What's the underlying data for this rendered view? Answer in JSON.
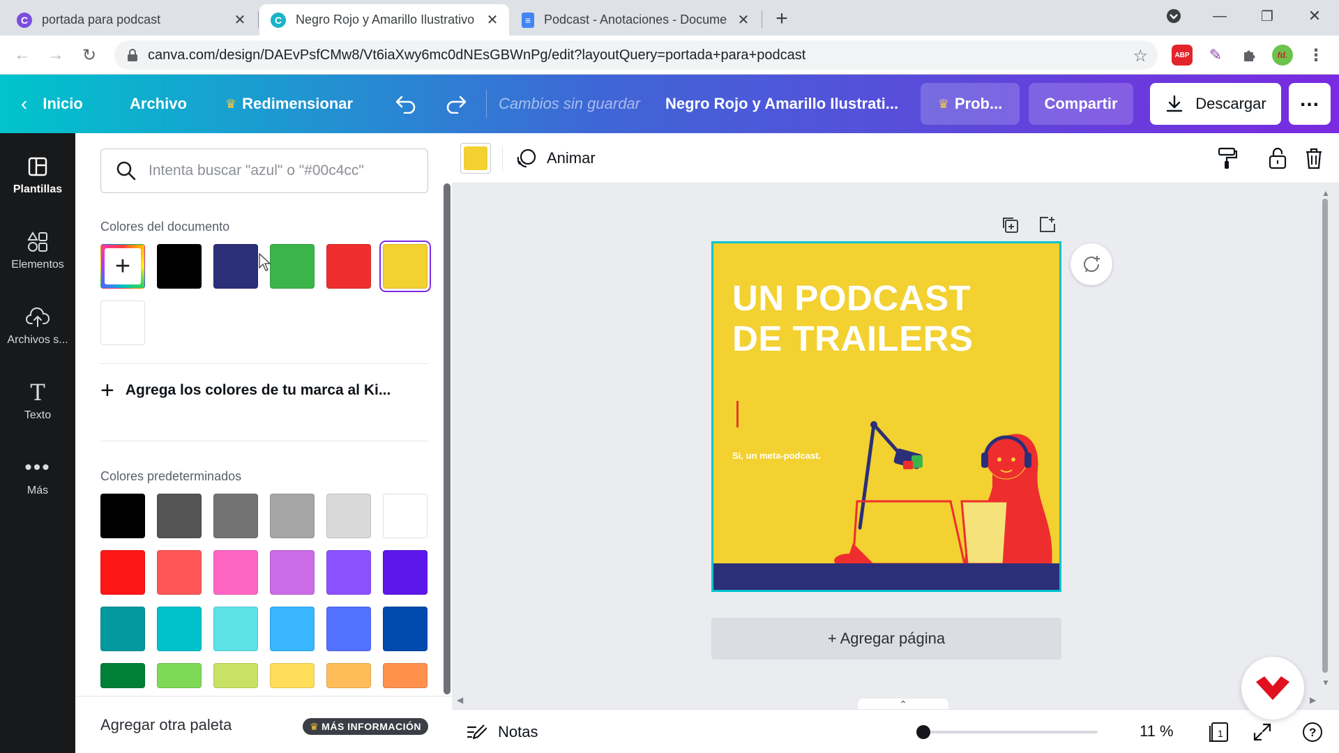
{
  "browser": {
    "tabs": [
      {
        "title": "portada para podcast",
        "favicon": "canva-icon"
      },
      {
        "title": "Negro Rojo y Amarillo Ilustrativo",
        "favicon": "canva-icon"
      },
      {
        "title": "Podcast - Anotaciones - Docume",
        "favicon": "google-docs-icon"
      }
    ],
    "url": "canva.com/design/DAEvPsfCMw8/Vt6iaXwy6mc0dNEsGBWnPg/edit?layoutQuery=portada+para+podcast",
    "ext_abp": "ABP",
    "profile_initials": "fd."
  },
  "header": {
    "home": "Inicio",
    "file": "Archivo",
    "resize": "Redimensionar",
    "status": "Cambios sin guardar",
    "doc_title": "Negro Rojo y Amarillo Ilustrati...",
    "try_pro": "Prob...",
    "share": "Compartir",
    "download": "Descargar"
  },
  "rail": [
    {
      "label": "Plantillas",
      "icon": "templates-icon"
    },
    {
      "label": "Elementos",
      "icon": "elements-icon"
    },
    {
      "label": "Archivos s...",
      "icon": "upload-cloud-icon"
    },
    {
      "label": "Texto",
      "icon": "text-icon"
    },
    {
      "label": "Más",
      "icon": "more-icon"
    }
  ],
  "panel": {
    "search_placeholder": "Intenta buscar \"azul\" o \"#00c4cc\"",
    "doc_colors_title": "Colores del documento",
    "doc_colors": [
      "#000000",
      "#2b2f78",
      "#3bb54a",
      "#ee2e2e",
      "#f2d130",
      "#ffffff"
    ],
    "selected_doc_color": "#f2d130",
    "add_brand": "Agrega los colores de tu marca al Ki...",
    "default_colors_title": "Colores predeterminados",
    "default_colors": [
      [
        "#000000",
        "#545454",
        "#737373",
        "#a6a6a6",
        "#d9d9d9",
        "#ffffff"
      ],
      [
        "#ff1616",
        "#ff5757",
        "#ff66c4",
        "#cb6ce6",
        "#8c52ff",
        "#5e17eb"
      ],
      [
        "#03989e",
        "#00c2cb",
        "#5ce1e6",
        "#38b6ff",
        "#5271ff",
        "#004aad"
      ],
      [
        "#008037",
        "#7ed957",
        "#c9e265",
        "#ffde59",
        "#ffbd59",
        "#ff914d"
      ]
    ],
    "footer_label": "Agregar otra paleta",
    "footer_badge": "MÁS INFORMACIÓN"
  },
  "toolbar": {
    "current_color": "#f2d130",
    "animate": "Animar"
  },
  "design": {
    "headline_1": "UN PODCAST",
    "headline_2": "DE TRAILERS",
    "subtitle": "Si, un meta-podcast.",
    "background": "#f2d130",
    "stripe": "#2b2f78"
  },
  "canvas": {
    "add_page": "+ Agregar página"
  },
  "bottom": {
    "notes": "Notas",
    "zoom_label": "11 %",
    "zoom_level": 0.11,
    "page_count": "1"
  }
}
